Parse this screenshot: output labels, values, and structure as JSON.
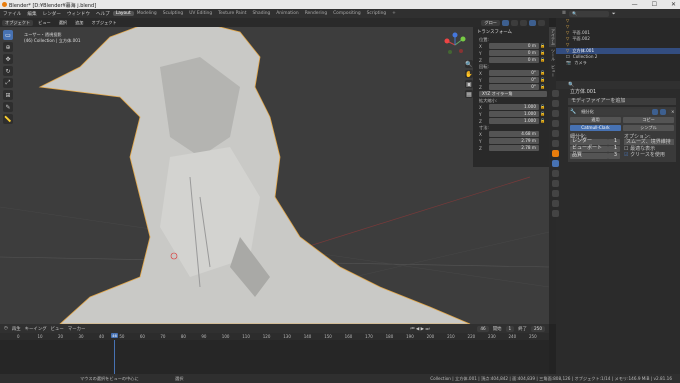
{
  "window": {
    "title": "Blender* [D:¥Blender¥暮海 j.blend]",
    "minimize": "—",
    "maximize": "☐",
    "close": "✕"
  },
  "menu": [
    "ファイル",
    "編集",
    "レンダー",
    "ウィンドウ",
    "ヘルプ"
  ],
  "workspaces": [
    "Layout",
    "Modeling",
    "Sculpting",
    "UV Editing",
    "Texture Paint",
    "Shading",
    "Animation",
    "Rendering",
    "Compositing",
    "Scripting",
    "+"
  ],
  "scene": "Scene",
  "view_layer": "View Layer",
  "viewport_header": [
    "オブジェクト",
    "ビュー",
    "選択",
    "追加",
    "オブジェクト"
  ],
  "viewport_header_right": [
    "グロー",
    "",
    "",
    "",
    ""
  ],
  "viewport_info": {
    "line1": "ユーザー・透視投影",
    "line2": "(46) Collection | 立方体.001"
  },
  "npanel": {
    "title": "トランスフォーム",
    "location_label": "位置:",
    "location": [
      {
        "axis": "X",
        "value": "0 m"
      },
      {
        "axis": "Y",
        "value": "0 m"
      },
      {
        "axis": "Z",
        "value": "0 m"
      }
    ],
    "rotation_label": "回転:",
    "rotation": [
      {
        "axis": "X",
        "value": "0°"
      },
      {
        "axis": "Y",
        "value": "0°"
      },
      {
        "axis": "Z",
        "value": "0°"
      }
    ],
    "mode": "XYZ オイラー角",
    "scale_label": "拡大縮小:",
    "scale": [
      {
        "axis": "X",
        "value": "1.000"
      },
      {
        "axis": "Y",
        "value": "1.000"
      },
      {
        "axis": "Z",
        "value": "1.000"
      }
    ],
    "dim_label": "寸法:",
    "dimensions": [
      {
        "axis": "X",
        "value": "4.68 m"
      },
      {
        "axis": "Y",
        "value": "2.79 m"
      },
      {
        "axis": "Z",
        "value": "2.78 m"
      }
    ]
  },
  "vtabs": [
    "アイテム",
    "ツール",
    "ビュー"
  ],
  "outliner": {
    "rows": [
      {
        "label": "",
        "sel": false
      },
      {
        "label": "",
        "sel": false
      },
      {
        "label": "平面.001",
        "sel": false
      },
      {
        "label": "平面.002",
        "sel": false
      },
      {
        "label": "",
        "sel": false
      },
      {
        "label": "立方体.001",
        "sel": true
      },
      {
        "label": "Collection 2",
        "sel": false
      },
      {
        "label": "カメラ",
        "sel": false
      }
    ]
  },
  "properties": {
    "object": "立方体.001",
    "modifier_add": "モディファイアーを追加",
    "modifier_name": "細分化",
    "apply": "適用",
    "copy": "コピー",
    "subdiv_tabs": [
      "Catmull-Clark",
      "シンプル"
    ],
    "subdiv_label": "細分化:",
    "options_label": "オプション:",
    "rows": [
      {
        "label": "レンダー",
        "value": "1"
      },
      {
        "label": "ビューポート",
        "value": "1"
      },
      {
        "label": "品質",
        "value": "3"
      }
    ],
    "opt_smooth": "スムーズ、境界維持",
    "opt_optimal": "最適な表示",
    "opt_crease": "クリースを使用"
  },
  "timeline": {
    "menu": [
      "再生",
      "キーイング",
      "ビュー",
      "マーカー"
    ],
    "current": "46",
    "start_label": "開始",
    "start": "1",
    "end_label": "終了",
    "end": "250",
    "ticks": [
      "0",
      "10",
      "20",
      "30",
      "40",
      "50",
      "60",
      "70",
      "80",
      "90",
      "100",
      "110",
      "120",
      "130",
      "140",
      "150",
      "160",
      "170",
      "180",
      "190",
      "200",
      "210",
      "220",
      "230",
      "240",
      "250"
    ]
  },
  "status": {
    "left": "マウスの選択をビューの中心に",
    "mid": "選択",
    "right": "Collection | 立方体.001 | 頂点:404,842 | 面:404,839 | 三角面:808,126 | オブジェクト:1/14 | メモリ:146.9 MiB | v2.81.16"
  },
  "colors": {
    "accent": "#4772b3",
    "orange": "#e87d0d"
  }
}
